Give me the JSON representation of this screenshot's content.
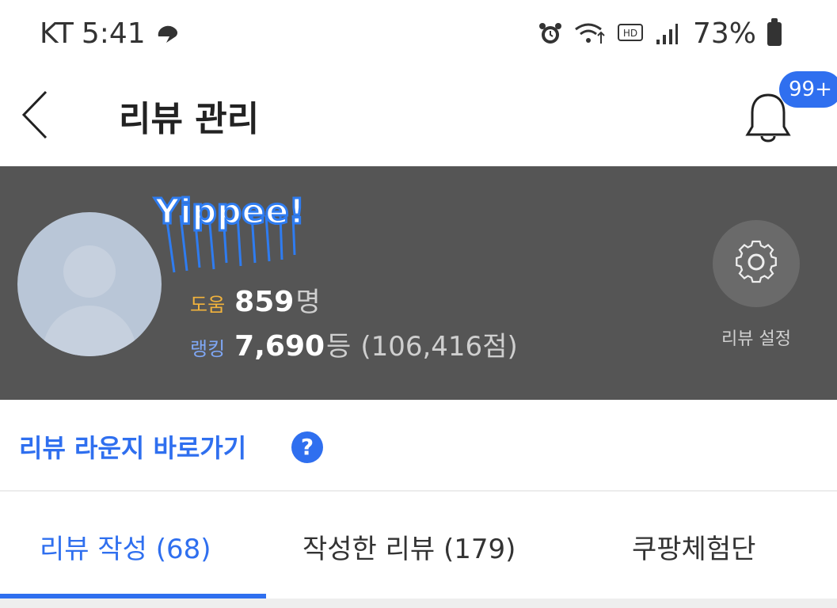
{
  "status_bar": {
    "carrier": "KT",
    "time": "5:41",
    "battery": "73%"
  },
  "header": {
    "title": "리뷰 관리",
    "notification_badge": "99+"
  },
  "profile": {
    "sticker_text": "Yippee!",
    "help_label": "도움",
    "help_value": "859",
    "help_unit": "명",
    "rank_label": "랭킹",
    "rank_value": "7,690",
    "rank_unit": "등",
    "rank_score": "(106,416점)",
    "settings_label": "리뷰 설정"
  },
  "lounge": {
    "link_text": "리뷰 라운지 바로가기",
    "help_icon_text": "?"
  },
  "tabs": [
    {
      "label": "리뷰 작성 (68)",
      "active": true
    },
    {
      "label": "작성한 리뷰 (179)",
      "active": false
    },
    {
      "label": "쿠팡체험단",
      "active": false
    }
  ],
  "icons": {
    "back": "chevron-left-icon",
    "bell": "bell-icon",
    "settings": "gear-icon",
    "help": "question-circle-icon"
  },
  "colors": {
    "accent": "#2f6fef",
    "panel_bg": "#555555",
    "help_label": "#f2b33c",
    "rank_label": "#7fa7f5"
  }
}
